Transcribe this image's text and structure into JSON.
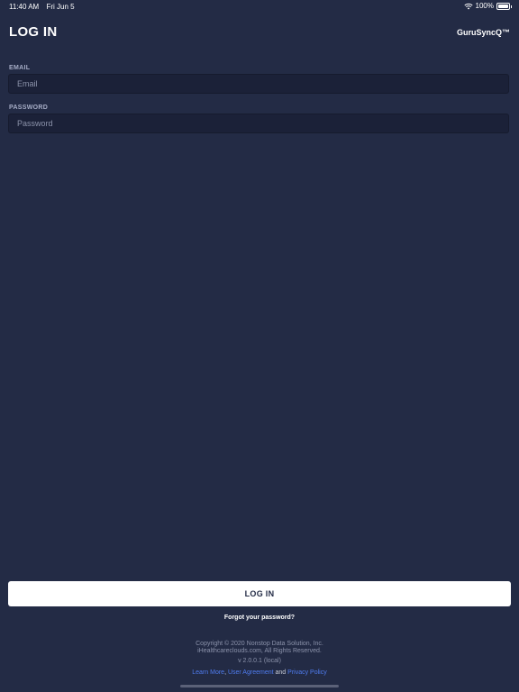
{
  "status_bar": {
    "time": "11:40 AM",
    "date": "Fri Jun 5",
    "battery": "100%"
  },
  "header": {
    "title": "LOG IN",
    "brand": "GuruSyncQ™"
  },
  "form": {
    "email_label": "EMAIL",
    "email_placeholder": "Email",
    "email_value": "",
    "password_label": "PASSWORD",
    "password_placeholder": "Password",
    "password_value": ""
  },
  "actions": {
    "login_label": "LOG IN",
    "forgot_label": "Forgot your password?"
  },
  "footer": {
    "copyright_1": "Copyright © 2020 Nonstop Data Solution, Inc.",
    "copyright_2": "iHealthcareclouds.com, All Rights Reserved.",
    "version": "v 2.0.0.1 (local)",
    "learn_more": "Learn More",
    "comma": ",",
    "user_agreement": "User Agreement",
    "and": "and",
    "privacy_policy": "Privacy Policy"
  }
}
